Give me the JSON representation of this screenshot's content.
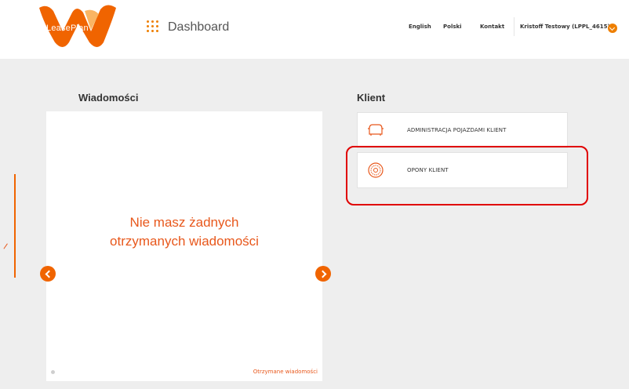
{
  "header": {
    "logo_text": "LeasePlan",
    "title": "Dashboard",
    "nav": [
      "English",
      "Polski",
      "Kontakt"
    ],
    "user": "Kristoff Testowy  (LPPL_4615)",
    "user_menu_icon": "chevron-down-icon"
  },
  "messages": {
    "title": "Wiadomości",
    "empty_line1": "Nie masz żadnych",
    "empty_line2": "otrzymanych wiadomości",
    "link": "Otrzymane wiadomości",
    "prev_icon": "chevron-left-icon",
    "next_icon": "chevron-right-icon"
  },
  "client": {
    "title": "Klient",
    "cards": [
      {
        "label": "ADMINISTRACJA POJAZDAMI KLIENT",
        "icon": "car-icon"
      },
      {
        "label": "OPONY KLIENT",
        "icon": "tire-icon"
      }
    ]
  },
  "colors": {
    "accent": "#f06400",
    "text_accent": "#e8581c",
    "highlight": "#e00000",
    "background": "#eeeeee"
  }
}
